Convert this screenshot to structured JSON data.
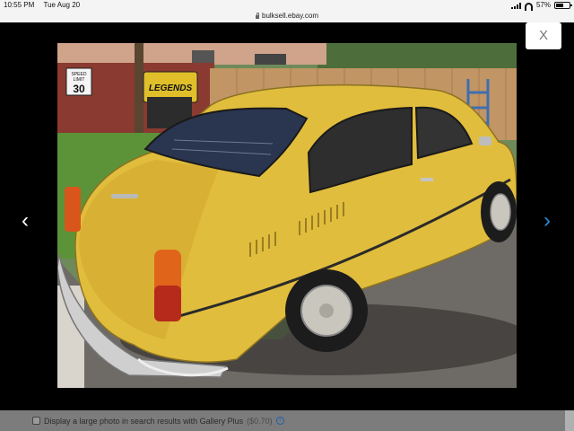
{
  "status_bar": {
    "time": "10:55 PM",
    "date": "Tue Aug 20",
    "battery": "57%",
    "battery_level": 0.57
  },
  "browser": {
    "url": "bulksell.ebay.com"
  },
  "lightbox": {
    "close_label": "X",
    "prev_label": "‹",
    "next_label": "›"
  },
  "photo_signs": {
    "speed_limit_top": "SPEED",
    "speed_limit_mid": "LIMIT",
    "speed_limit_value": "30",
    "legends_sign": "LEGENDS"
  },
  "gallery_option": {
    "label": "Display a large photo in search results with Gallery Plus",
    "price": "($0.70)",
    "info_label": "i",
    "checked": false
  },
  "colors": {
    "car_body": "#e1bd3d",
    "accent_blue": "#2a8ad6",
    "status_bar_bg": "#f4f4f4"
  }
}
